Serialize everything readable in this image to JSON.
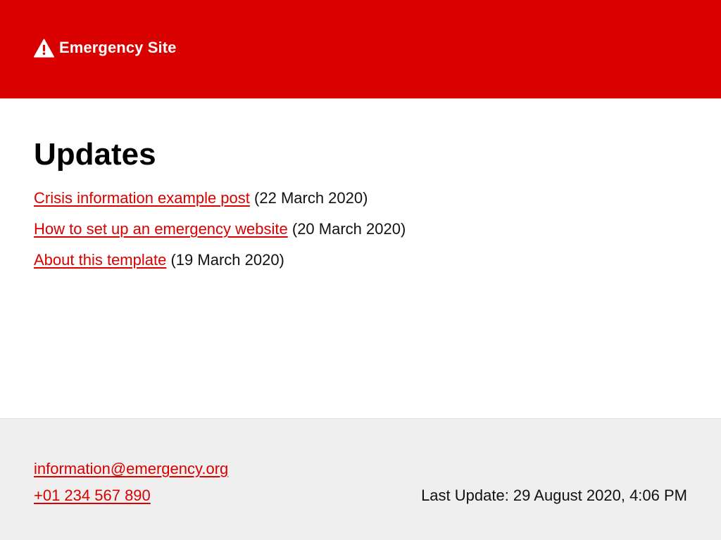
{
  "header": {
    "icon": "warning-triangle-icon",
    "site_title": "Emergency Site",
    "background_color": "#d90000"
  },
  "main": {
    "title": "Updates",
    "posts": [
      {
        "title": "Crisis information example post",
        "date": "(22 March 2020)"
      },
      {
        "title": "How to set up an emergency website",
        "date": "(20 March 2020)"
      },
      {
        "title": "About this template",
        "date": "(19 March 2020)"
      }
    ],
    "link_color": "#d90000"
  },
  "footer": {
    "email": "information@emergency.org",
    "phone": "+01 234 567 890",
    "last_update": "Last Update: 29 August 2020, 4:06 PM",
    "background_color": "#efefef"
  }
}
